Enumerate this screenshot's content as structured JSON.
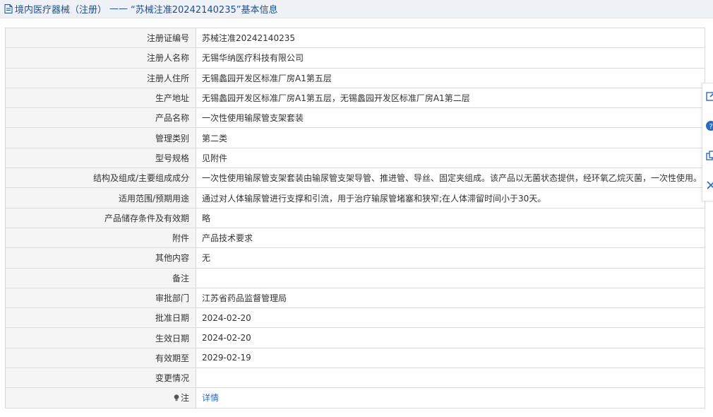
{
  "header": {
    "category": "境内医疗器械（注册）",
    "separator": "——",
    "cert_title": "“苏械注准20242140235”",
    "suffix": "基本信息"
  },
  "rows": [
    {
      "label": "注册证编号",
      "value": "苏械注准20242140235"
    },
    {
      "label": "注册人名称",
      "value": "无锡华纳医疗科技有限公司"
    },
    {
      "label": "注册人住所",
      "value": "无锡蠡园开发区标准厂房A1第五层"
    },
    {
      "label": "生产地址",
      "value": "无锡蠡园开发区标准厂房A1第五层，无锡蠡园开发区标准厂房A1第二层"
    },
    {
      "label": "产品名称",
      "value": "一次性使用输尿管支架套装"
    },
    {
      "label": "管理类别",
      "value": "第二类"
    },
    {
      "label": "型号规格",
      "value": "见附件"
    },
    {
      "label": "结构及组成/主要组成成分",
      "value": "一次性使用输尿管支架套装由输尿管支架导管、推进管、导丝、固定夹组成。该产品以无菌状态提供，经环氧乙烷灭菌，一次性使用。"
    },
    {
      "label": "适用范围/预期用途",
      "value": "通过对人体输尿管进行支撑和引流，用于治疗输尿管堵塞和狭窄;在人体滞留时间小于30天。"
    },
    {
      "label": "产品储存条件及有效期",
      "value": "略"
    },
    {
      "label": "附件",
      "value": "产品技术要求"
    },
    {
      "label": "其他内容",
      "value": "无"
    },
    {
      "label": "备注",
      "value": ""
    },
    {
      "label": "审批部门",
      "value": "江苏省药品监督管理局"
    },
    {
      "label": "批准日期",
      "value": "2024-02-20"
    },
    {
      "label": "生效日期",
      "value": "2024-02-20"
    },
    {
      "label": "有效期至",
      "value": "2029-02-19"
    },
    {
      "label": "变更情况",
      "value": ""
    }
  ],
  "note_row": {
    "label": "注",
    "link": "详情"
  },
  "colors": {
    "link": "#2a6bbf",
    "title": "#1f4e8c",
    "label_bg": "#f5f5f5"
  }
}
